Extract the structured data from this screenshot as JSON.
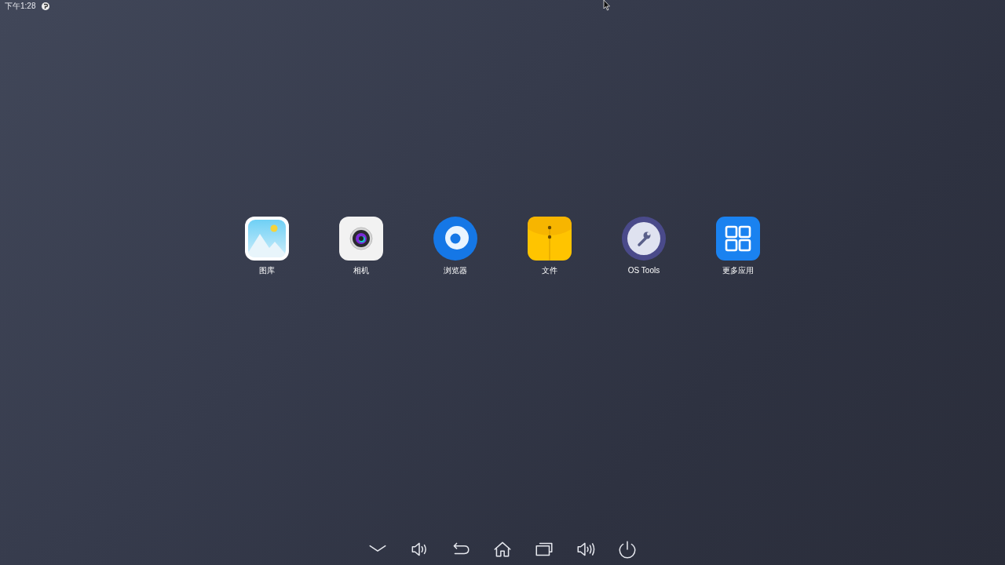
{
  "status_bar": {
    "time": "下午1:28"
  },
  "apps": [
    {
      "kind": "gallery",
      "label": "图库"
    },
    {
      "kind": "camera",
      "label": "相机"
    },
    {
      "kind": "browser",
      "label": "浏览器"
    },
    {
      "kind": "files",
      "label": "文件"
    },
    {
      "kind": "tools",
      "label": "OS Tools"
    },
    {
      "kind": "more",
      "label": "更多应用"
    }
  ],
  "nav_bar": [
    {
      "kind": "collapse"
    },
    {
      "kind": "volume_down"
    },
    {
      "kind": "back"
    },
    {
      "kind": "home"
    },
    {
      "kind": "recents"
    },
    {
      "kind": "volume_up"
    },
    {
      "kind": "power"
    }
  ]
}
